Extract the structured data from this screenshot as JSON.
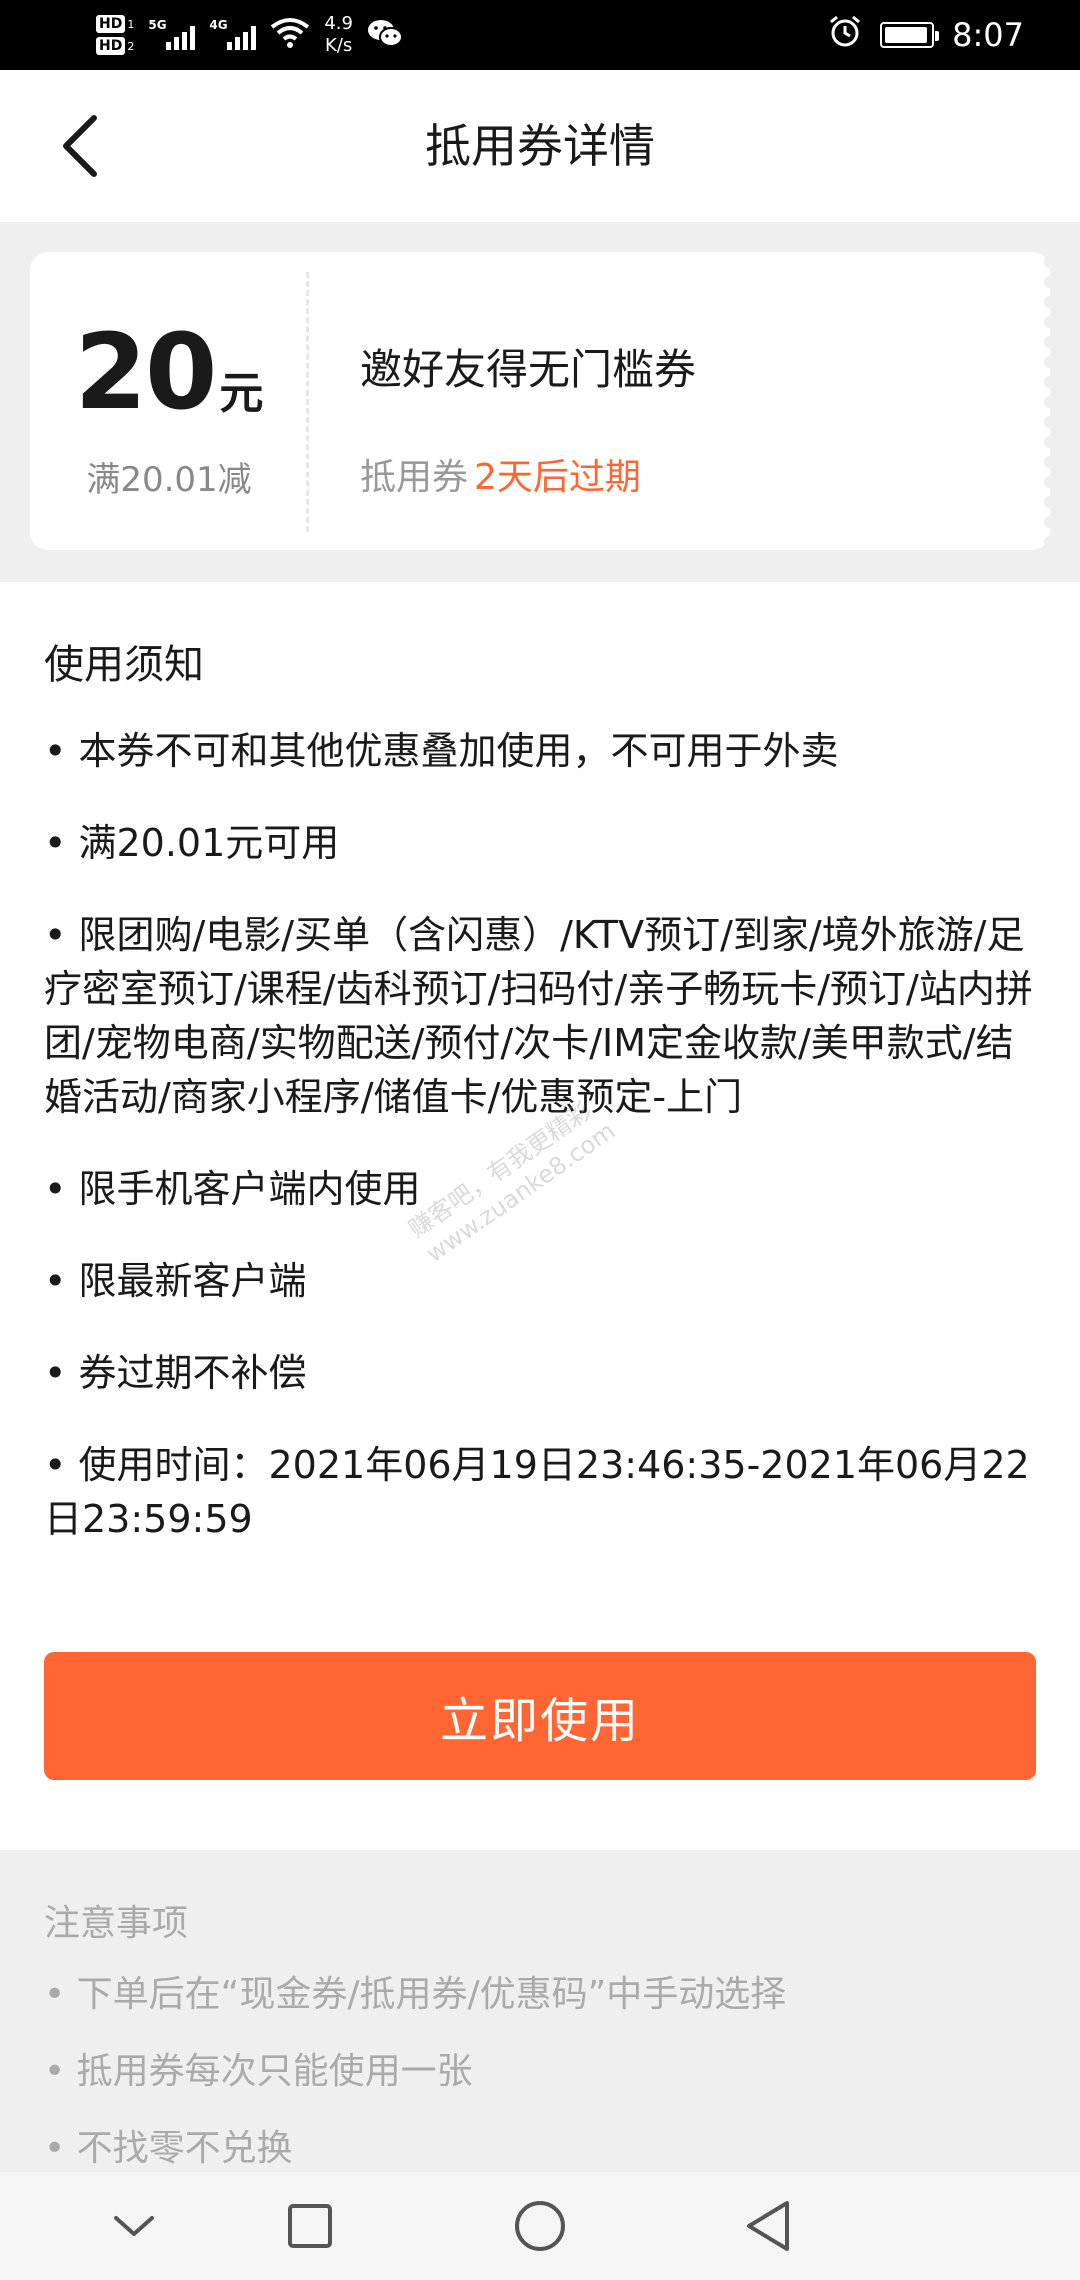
{
  "status_bar": {
    "hd1": "HD",
    "hd1_sub": "1",
    "hd2": "HD",
    "hd2_sub": "2",
    "net1": "5G",
    "net2": "4G",
    "speed_value": "4.9",
    "speed_unit": "K/s",
    "time": "8:07",
    "battery_level": 0.95
  },
  "header": {
    "title": "抵用券详情",
    "back_icon": "chevron-left-icon"
  },
  "coupon": {
    "amount": "20",
    "unit": "元",
    "condition": "满20.01减",
    "name": "邀好友得无门槛券",
    "type": "抵用券",
    "expiry": "2天后过期"
  },
  "notice": {
    "title": "使用须知",
    "rules": [
      "• 本券不可和其他优惠叠加使用，不可用于外卖",
      "• 满20.01元可用",
      "• 限团购/电影/买单（含闪惠）/KTV预订/到家/境外旅游/足疗密室预订/课程/齿科预订/扫码付/亲子畅玩卡/预订/站内拼团/宠物电商/实物配送/预付/次卡/IM定金收款/美甲款式/结婚活动/商家小程序/储值卡/优惠预定-上门",
      "• 限手机客户端内使用",
      "• 限最新客户端",
      "• 券过期不补偿",
      "• 使用时间：2021年06月19日23:46:35-2021年06月22日23:59:59"
    ],
    "button_label": "立即使用"
  },
  "tips": {
    "title": "注意事项",
    "items": [
      "• 下单后在“现金券/抵用券/优惠码”中手动选择",
      "• 抵用券每次只能使用一张",
      "• 不找零不兑换"
    ]
  },
  "watermark": {
    "line1": "赚客吧，有我更精彩",
    "line2": "www.zuanke8.com"
  },
  "colors": {
    "accent": "#ff6633",
    "page_bg": "#efefef"
  }
}
